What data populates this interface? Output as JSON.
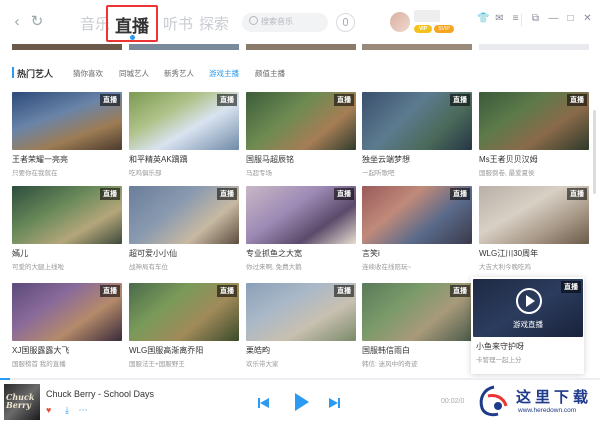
{
  "header": {
    "tabs": [
      {
        "label": "音乐"
      },
      {
        "label": "直播"
      },
      {
        "label": "听书"
      },
      {
        "label": "探索"
      }
    ],
    "search_placeholder": "搜索音乐",
    "vip_label": "VIP",
    "vip_label_2": "SVIP"
  },
  "categories": [
    {
      "label": "热门艺人"
    },
    {
      "label": "猜你喜欢"
    },
    {
      "label": "同城艺人"
    },
    {
      "label": "新秀艺人"
    },
    {
      "label": "游戏主播"
    },
    {
      "label": "颜值主播"
    }
  ],
  "live_badge": "直播",
  "cards": [
    {
      "title": "王者荣耀一亮亮",
      "sub": "只要你在我就在"
    },
    {
      "title": "和平精英AK踽踽",
      "sub": "吃鸡俱乐部"
    },
    {
      "title": "国服马超辰铭",
      "sub": "马超专场"
    },
    {
      "title": "独坐云端梦想",
      "sub": "一起听歌吧"
    },
    {
      "title": "Ms王者贝贝汉姆",
      "sub": "国服倒卷, 最爱夏侯"
    },
    {
      "title": "嫣儿",
      "sub": "可爱的大腿上线啦"
    },
    {
      "title": "超可爱小小仙",
      "sub": "战神局有车位"
    },
    {
      "title": "专业抓鱼之大宽",
      "sub": "你过来啊, 免费大鹅"
    },
    {
      "title": "言笑i",
      "sub": "连续收在线陪玩~"
    },
    {
      "title": "WLG江川30周年",
      "sub": "大吉大利今晚吃鸡"
    },
    {
      "title": "XJ国服露露大飞",
      "sub": "国服榜首 我的直播"
    },
    {
      "title": "WLG国服高渐离乔阳",
      "sub": "国服法王+国服野王"
    },
    {
      "title": "栗皓畇",
      "sub": "欢乐带大家"
    },
    {
      "title": "国服韩信雨白",
      "sub": "韩信: 迷风中的奇迹"
    },
    {
      "title": "小鱼来守护呀",
      "sub": "卡管理一起上分",
      "overlay": "游戏直播"
    }
  ],
  "player": {
    "song": "Chuck Berry - School Days",
    "album_art_text": "Chuck Berry",
    "time": "00:02/0"
  },
  "watermark": {
    "title": "这里下载",
    "url": "www.heredown.com"
  }
}
